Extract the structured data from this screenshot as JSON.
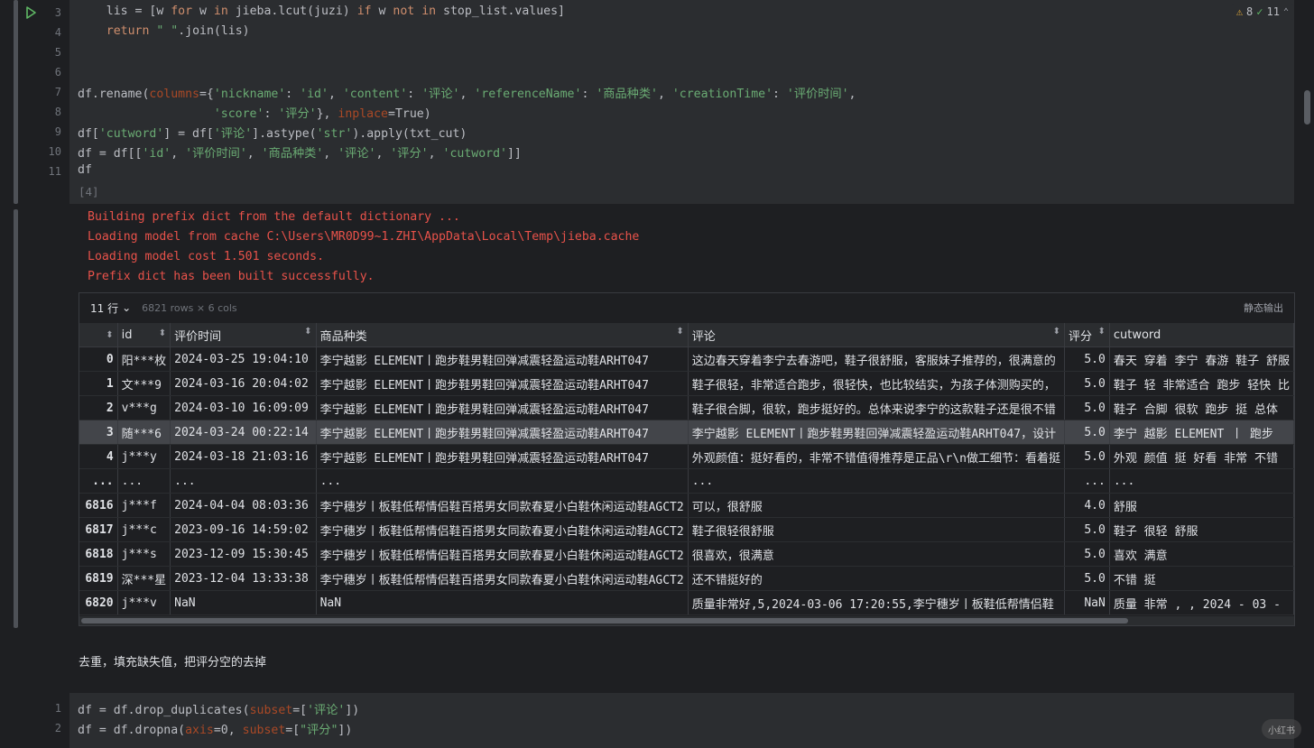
{
  "cell1": {
    "line_numbers": [
      "3",
      "4",
      "5",
      "6",
      "7",
      "8",
      "9",
      "10",
      "11"
    ],
    "lines": [
      "    lis = [w for w in jieba.lcut(juzi) if w not in stop_list.values]",
      "    return \" \".join(lis)",
      "",
      "",
      "df.rename(columns={'nickname': 'id', 'content': '评论', 'referenceName': '商品种类', 'creationTime': '评价时间',",
      "                   'score': '评分'}, inplace=True)",
      "df['cutword'] = df['评论'].astype('str').apply(txt_cut)",
      "df = df[['id', '评价时间', '商品种类', '评论', '评分', 'cutword']]",
      "df"
    ],
    "exec_count": "[4]",
    "badge": {
      "warnings": "8",
      "checks": "11"
    }
  },
  "stderr": [
    "Building prefix dict from the default dictionary ...",
    "Loading model from cache C:\\Users\\MR0D99~1.ZHI\\AppData\\Local\\Temp\\jieba.cache",
    "Loading model cost 1.501 seconds.",
    "Prefix dict has been built successfully."
  ],
  "table": {
    "rows_selector": "11 行",
    "rows_info": "6821 rows × 6 cols",
    "static_output": "静态输出",
    "columns": [
      "",
      "id",
      "评价时间",
      "商品种类",
      "评论",
      "评分",
      "cutword"
    ],
    "rows": [
      [
        "0",
        "阳***枚",
        "2024-03-25 19:04:10",
        "李宁越影 ELEMENT丨跑步鞋男鞋回弹减震轻盈运动鞋ARHT047",
        "这边春天穿着李宁去春游吧，鞋子很舒服，客服妹子推荐的，很满意的",
        "5.0",
        "春天 穿着 李宁 春游 鞋子 舒服"
      ],
      [
        "1",
        "文***9",
        "2024-03-16 20:04:02",
        "李宁越影 ELEMENT丨跑步鞋男鞋回弹减震轻盈运动鞋ARHT047",
        "鞋子很轻，非常适合跑步，很轻快，也比较结实，为孩子体测购买的，",
        "5.0",
        "鞋子 轻 非常适合 跑步 轻快 比"
      ],
      [
        "2",
        "v***g",
        "2024-03-10 16:09:09",
        "李宁越影 ELEMENT丨跑步鞋男鞋回弹减震轻盈运动鞋ARHT047",
        "鞋子很合脚，很软，跑步挺好的。总体来说李宁的这款鞋子还是很不错",
        "5.0",
        "鞋子 合脚 很软 跑步 挺 总体"
      ],
      [
        "3",
        "随***6",
        "2024-03-24 00:22:14",
        "李宁越影 ELEMENT丨跑步鞋男鞋回弹减震轻盈运动鞋ARHT047",
        "李宁越影 ELEMENT丨跑步鞋男鞋回弹减震轻盈运动鞋ARHT047，设计",
        "5.0",
        "李宁 越影   ELEMENT  丨  跑步"
      ],
      [
        "4",
        "j***y",
        "2024-03-18 21:03:16",
        "李宁越影 ELEMENT丨跑步鞋男鞋回弹减震轻盈运动鞋ARHT047",
        "外观颜值：挺好看的，非常不错值得推荐是正品\\r\\n做工细节：看着挺",
        "5.0",
        "外观 颜值 挺 好看 非常 不错"
      ],
      [
        "...",
        "...",
        "...",
        "...",
        "...",
        "...",
        "..."
      ],
      [
        "6816",
        "j***f",
        "2024-04-04 08:03:36",
        "李宁穗岁丨板鞋低帮情侣鞋百搭男女同款春夏小白鞋休闲运动鞋AGCT2",
        "可以，很舒服",
        "4.0",
        "舒服"
      ],
      [
        "6817",
        "j***c",
        "2023-09-16 14:59:02",
        "李宁穗岁丨板鞋低帮情侣鞋百搭男女同款春夏小白鞋休闲运动鞋AGCT2",
        "鞋子很轻很舒服",
        "5.0",
        "鞋子 很轻 舒服"
      ],
      [
        "6818",
        "j***s",
        "2023-12-09 15:30:45",
        "李宁穗岁丨板鞋低帮情侣鞋百搭男女同款春夏小白鞋休闲运动鞋AGCT2",
        "很喜欢，很满意",
        "5.0",
        "喜欢 满意"
      ],
      [
        "6819",
        "深***星",
        "2023-12-04 13:33:38",
        "李宁穗岁丨板鞋低帮情侣鞋百搭男女同款春夏小白鞋休闲运动鞋AGCT2",
        "还不错挺好的",
        "5.0",
        "不错 挺"
      ],
      [
        "6820",
        "j***v",
        "NaN",
        "NaN",
        "质量非常好,5,2024-03-06 17:20:55,李宁穗岁丨板鞋低帮情侣鞋",
        "NaN",
        "质量 非常 , , 2024 - 03 -"
      ]
    ],
    "selected_row": 3
  },
  "markdown": "去重，填充缺失值，把评分空的去掉",
  "cell2": {
    "line_numbers": [
      "1",
      "2"
    ],
    "lines": [
      "df = df.drop_duplicates(subset=['评论'])",
      "df = df.dropna(axis=0, subset=[\"评分\"])"
    ]
  },
  "watermark": "小红书"
}
